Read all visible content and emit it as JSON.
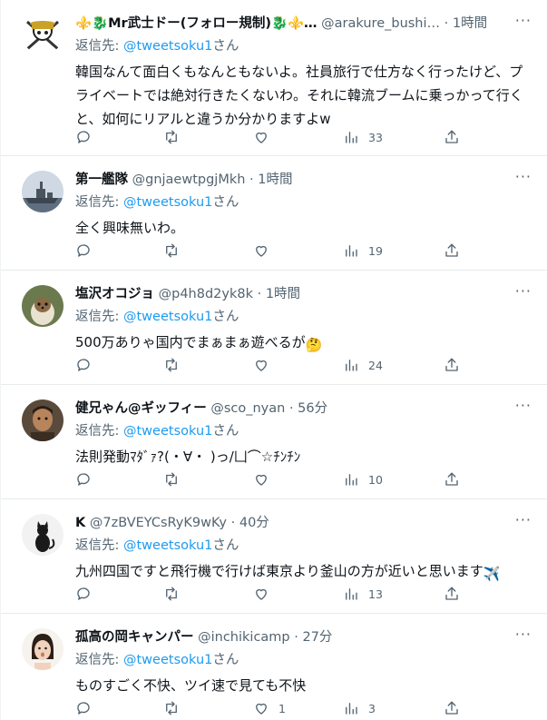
{
  "replying_to_prefix": "返信先: ",
  "replying_to_handle": "@tweetsoku1",
  "replying_to_suffix": "さん",
  "more_label": "···",
  "dot": "·",
  "tweets": [
    {
      "name": "⚜️🐉Mr武士ドー(フォロー規制)🐉⚜️…",
      "handle": "@arakure_bushi…",
      "time": "1時間",
      "text": "韓国なんて面白くもなんともないよ。社員旅行で仕方なく行ったけど、プライベートでは絶対行きたくないわ。それに韓流ブームに乗っかって行くと、如何にリアルと違うか分かりますよw",
      "replies": "",
      "retweets": "",
      "likes": "",
      "views": "33"
    },
    {
      "name": "第一艦隊",
      "handle": "@gnjaewtpgjMkh",
      "time": "1時間",
      "text": "全く興味無いわ。",
      "replies": "",
      "retweets": "",
      "likes": "",
      "views": "19"
    },
    {
      "name": "塩沢オコジョ",
      "handle": "@p4h8d2yk8k",
      "time": "1時間",
      "text": "500万ありゃ国内でまぁまぁ遊べるが",
      "text_emoji": "🤔",
      "replies": "",
      "retweets": "",
      "likes": "",
      "views": "24"
    },
    {
      "name": "健兄ゃん@ギッフィー",
      "handle": "@sco_nyan",
      "time": "56分",
      "text": "法則発動ﾏﾀﾞｧ?(・∀・ )っ/凵⌒☆ﾁﾝﾁﾝ",
      "replies": "",
      "retweets": "",
      "likes": "",
      "views": "10"
    },
    {
      "name": "K",
      "handle": "@7zBVEYCsRyK9wKy",
      "time": "40分",
      "text": "九州四国ですと飛行機で行けば東京より釜山の方が近いと思います",
      "text_emoji": "✈️",
      "replies": "",
      "retweets": "",
      "likes": "",
      "views": "13"
    },
    {
      "name": "孤高の岡キャンパー",
      "handle": "@inchikicamp",
      "time": "27分",
      "text": "ものすごく不快、ツイ速で見ても不快",
      "replies": "",
      "retweets": "",
      "likes": "1",
      "views": "3"
    }
  ]
}
